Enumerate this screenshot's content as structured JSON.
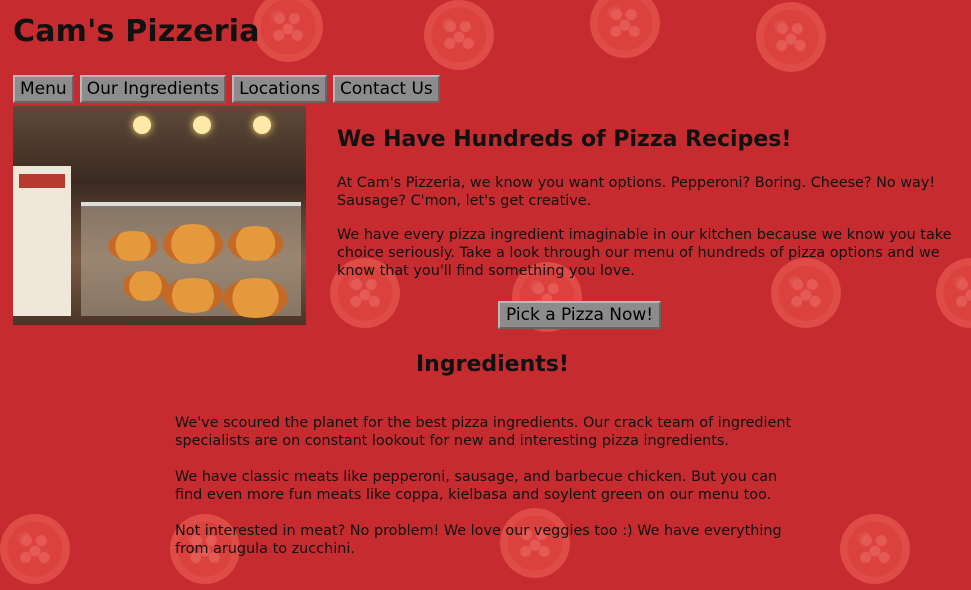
{
  "header": {
    "title": "Cam's Pizzeria"
  },
  "nav": {
    "items": [
      "Menu",
      "Our Ingredients",
      "Locations",
      "Contact Us"
    ]
  },
  "recipes": {
    "heading": "We Have Hundreds of Pizza Recipes!",
    "p1": "At Cam's Pizzeria, we know you want options. Pepperoni? Boring. Cheese? No way! Sausage? C'mon, let's get creative.",
    "p2": "We have every pizza ingredient imaginable in our kitchen because we know you take choice seriously. Take a look through our menu of hundreds of pizza options and we know that you'll find something you love.",
    "cta_label": "Pick a Pizza Now!"
  },
  "ingredients": {
    "heading": "Ingredients!",
    "p1": "We've scoured the planet for the best pizza ingredients. Our crack team of ingredient specialists are on constant lookout for new and interesting pizza ingredients.",
    "p2": "We have classic meats like pepperoni, sausage, and barbecue chicken. But you can find even more fun meats like coppa, kielbasa and soylent green on our menu too.",
    "p3": "Not interested in meat? No problem! We love our veggies too :) We have everything from arugula to zucchini."
  },
  "colors": {
    "background": "#c62c2f",
    "button": "#8c8c8c"
  }
}
